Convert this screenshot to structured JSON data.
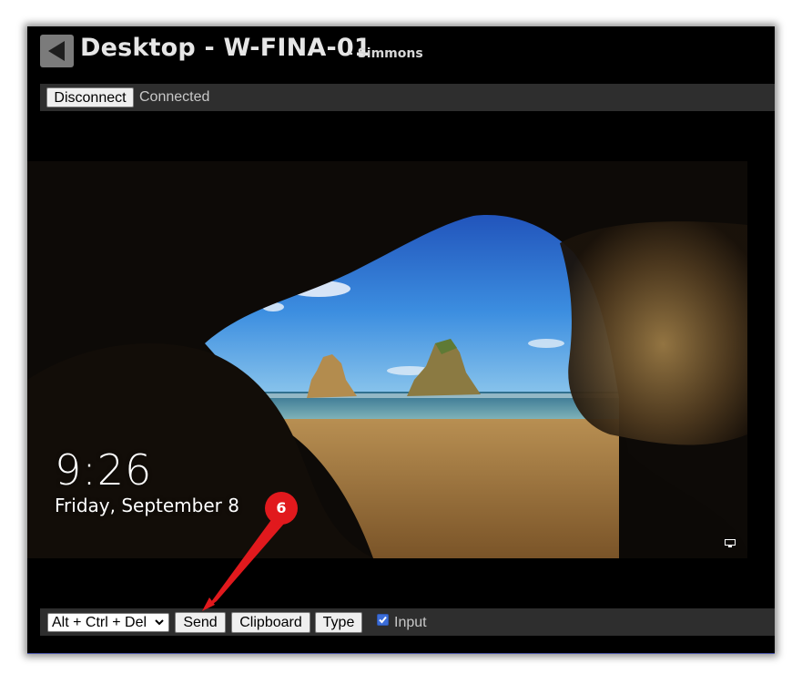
{
  "window": {
    "title": "Desktop - W-FINA-01",
    "subtitle": "- Simmons"
  },
  "toolbar_top": {
    "disconnect_label": "Disconnect",
    "status_text": "Connected"
  },
  "remote_screen": {
    "time": "9:26",
    "date": "Friday, September 8"
  },
  "toolbar_bottom": {
    "key_combo_selected": "Alt + Ctrl + Del",
    "send_label": "Send",
    "clipboard_label": "Clipboard",
    "type_label": "Type",
    "input_checkbox_label": "Input",
    "input_checked": true
  },
  "annotation": {
    "callout_number": "6",
    "callout_color": "#e1191d"
  },
  "icons": {
    "back": "back-arrow-icon",
    "network": "network-icon",
    "dropdown": "chevron-down-icon"
  }
}
